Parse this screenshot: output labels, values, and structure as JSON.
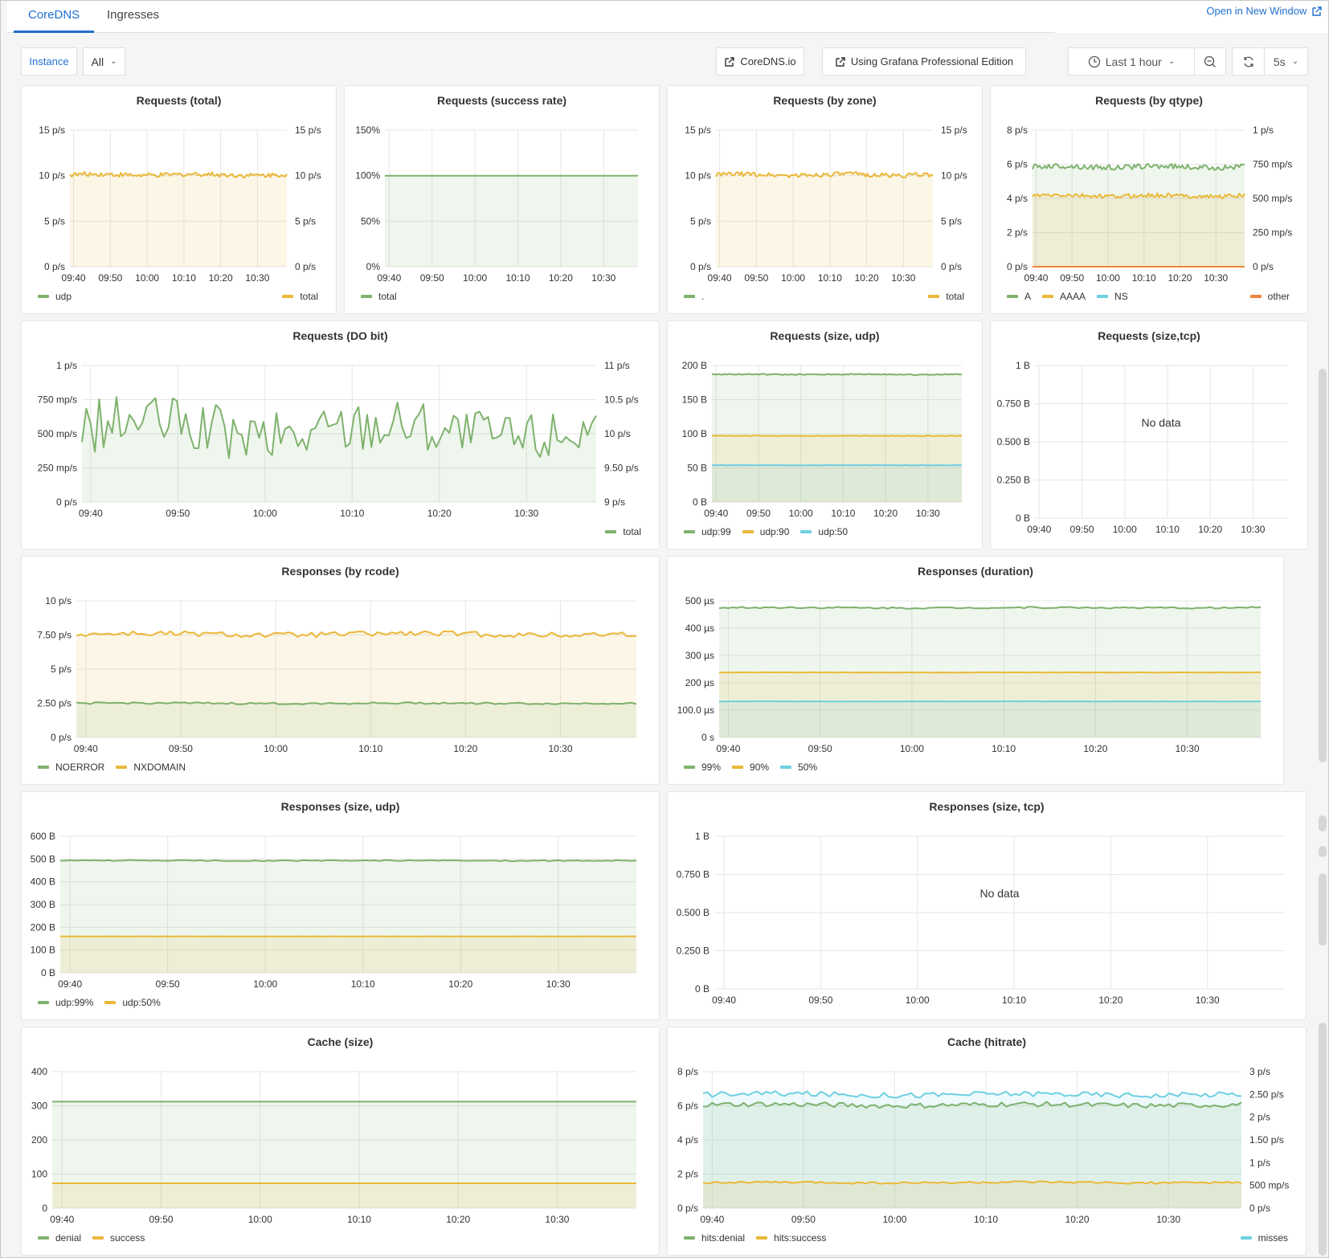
{
  "tabs": [
    {
      "label": "CoreDNS",
      "active": true
    },
    {
      "label": "Ingresses",
      "active": false
    }
  ],
  "open_new_window": "Open in New Window",
  "toolbar": {
    "variable_label": "Instance",
    "variable_value": "All",
    "link_coredns": "CoreDNS.io",
    "link_grafana": "Using Grafana Professional Edition",
    "time_range": "Last 1 hour",
    "refresh_interval": "5s"
  },
  "colors": {
    "green": "#7eb26d",
    "yellow": "#eab839",
    "cyan": "#6ed0e0",
    "orange": "#ef843c",
    "accent": "#1f6fd1"
  },
  "x_ticks": [
    "09:40",
    "09:50",
    "10:00",
    "10:10",
    "10:20",
    "10:30"
  ],
  "chart_data": [
    {
      "id": "req-total",
      "type": "area",
      "title": "Requests (total)",
      "yleft": {
        "ticks": [
          "0 p/s",
          "5 p/s",
          "10 p/s",
          "15 p/s"
        ],
        "range": [
          0,
          15
        ]
      },
      "yright": {
        "ticks": [
          "0 p/s",
          "5 p/s",
          "10 p/s",
          "15 p/s"
        ],
        "range": [
          0,
          15
        ]
      },
      "series": [
        {
          "name": "udp",
          "color": "#7eb26d",
          "axis": "left",
          "mean": null,
          "noise": 0,
          "legend_side": "left"
        },
        {
          "name": "total",
          "color": "#eab839",
          "axis": "right",
          "mean": 10.1,
          "noise": 0.25,
          "legend_side": "right"
        }
      ]
    },
    {
      "id": "req-success",
      "type": "area",
      "title": "Requests (success rate)",
      "yleft": {
        "ticks": [
          "0%",
          "50%",
          "100%",
          "150%"
        ],
        "range": [
          0,
          150
        ]
      },
      "series": [
        {
          "name": "total",
          "color": "#7eb26d",
          "axis": "left",
          "mean": 100,
          "noise": 0,
          "legend_side": "left"
        }
      ]
    },
    {
      "id": "req-zone",
      "type": "area",
      "title": "Requests (by zone)",
      "yleft": {
        "ticks": [
          "0 p/s",
          "5 p/s",
          "10 p/s",
          "15 p/s"
        ],
        "range": [
          0,
          15
        ]
      },
      "yright": {
        "ticks": [
          "0 p/s",
          "5 p/s",
          "10 p/s",
          "15 p/s"
        ],
        "range": [
          0,
          15
        ]
      },
      "series": [
        {
          "name": ".",
          "color": "#7eb26d",
          "axis": "left",
          "mean": null,
          "noise": 0,
          "legend_side": "left"
        },
        {
          "name": "total",
          "color": "#eab839",
          "axis": "right",
          "mean": 10.1,
          "noise": 0.25,
          "legend_side": "right"
        }
      ]
    },
    {
      "id": "req-qtype",
      "type": "area",
      "title": "Requests (by qtype)",
      "yleft": {
        "ticks": [
          "0 p/s",
          "2 p/s",
          "4 p/s",
          "6 p/s",
          "8 p/s"
        ],
        "range": [
          0,
          8
        ]
      },
      "yright": {
        "ticks": [
          "0 p/s",
          "250 mp/s",
          "500 mp/s",
          "750 mp/s",
          "1 p/s"
        ],
        "range": [
          0,
          1
        ]
      },
      "series": [
        {
          "name": "A",
          "color": "#7eb26d",
          "axis": "left",
          "mean": 5.85,
          "noise": 0.15,
          "legend_side": "left"
        },
        {
          "name": "AAAA",
          "color": "#eab839",
          "axis": "left",
          "mean": 4.15,
          "noise": 0.12,
          "legend_side": "left"
        },
        {
          "name": "NS",
          "color": "#6ed0e0",
          "axis": "left",
          "mean": null,
          "noise": 0,
          "legend_side": "left"
        },
        {
          "name": "other",
          "color": "#ef843c",
          "axis": "right",
          "mean": 0,
          "noise": 0,
          "legend_side": "right"
        }
      ]
    },
    {
      "id": "req-dobit",
      "type": "area",
      "title": "Requests (DO bit)",
      "yleft": {
        "ticks": [
          "0 p/s",
          "250 mp/s",
          "500 mp/s",
          "750 mp/s",
          "1 p/s"
        ],
        "range": [
          0,
          1
        ]
      },
      "yright": {
        "ticks": [
          "9 p/s",
          "9.50 p/s",
          "10 p/s",
          "10.5 p/s",
          "11 p/s"
        ],
        "range": [
          9,
          11
        ]
      },
      "series": [
        {
          "name": "total",
          "color": "#7eb26d",
          "axis": "left",
          "mean": 0.53,
          "noise": 0.2,
          "legend_side": "right"
        }
      ]
    },
    {
      "id": "req-size-udp",
      "type": "area",
      "title": "Requests (size, udp)",
      "yleft": {
        "ticks": [
          "0 B",
          "50 B",
          "100 B",
          "150 B",
          "200 B"
        ],
        "range": [
          0,
          200
        ]
      },
      "series": [
        {
          "name": "udp:99",
          "color": "#7eb26d",
          "axis": "left",
          "mean": 187,
          "noise": 0.8,
          "legend_side": "left"
        },
        {
          "name": "udp:90",
          "color": "#eab839",
          "axis": "left",
          "mean": 97,
          "noise": 0.5,
          "legend_side": "left"
        },
        {
          "name": "udp:50",
          "color": "#6ed0e0",
          "axis": "left",
          "mean": 54,
          "noise": 0.3,
          "legend_side": "left"
        }
      ]
    },
    {
      "id": "req-size-tcp",
      "type": "area",
      "title": "Requests (size,tcp)",
      "no_data": "No data",
      "yleft": {
        "ticks": [
          "0 B",
          "0.250 B",
          "0.500 B",
          "0.750 B",
          "1 B"
        ],
        "range": [
          0,
          1
        ]
      },
      "series": []
    },
    {
      "id": "resp-rcode",
      "type": "area",
      "title": "Responses (by rcode)",
      "yleft": {
        "ticks": [
          "0 p/s",
          "2.50 p/s",
          "5 p/s",
          "7.50 p/s",
          "10 p/s"
        ],
        "range": [
          0,
          10
        ]
      },
      "series": [
        {
          "name": "NOERROR",
          "color": "#7eb26d",
          "axis": "left",
          "mean": 2.5,
          "noise": 0.07,
          "legend_side": "left"
        },
        {
          "name": "NXDOMAIN",
          "color": "#eab839",
          "axis": "left",
          "mean": 7.55,
          "noise": 0.2,
          "legend_side": "left"
        }
      ]
    },
    {
      "id": "resp-duration",
      "type": "area",
      "title": "Responses (duration)",
      "yleft": {
        "ticks": [
          "0 s",
          "100.0 µs",
          "200 µs",
          "300 µs",
          "400 µs",
          "500 µs"
        ],
        "range": [
          0,
          500
        ]
      },
      "series": [
        {
          "name": "99%",
          "color": "#7eb26d",
          "axis": "left",
          "mean": 475,
          "noise": 3,
          "legend_side": "left"
        },
        {
          "name": "90%",
          "color": "#eab839",
          "axis": "left",
          "mean": 238,
          "noise": 0.5,
          "legend_side": "left"
        },
        {
          "name": "50%",
          "color": "#6ed0e0",
          "axis": "left",
          "mean": 132,
          "noise": 0.3,
          "legend_side": "left"
        }
      ]
    },
    {
      "id": "resp-size-udp",
      "type": "area",
      "title": "Responses (size, udp)",
      "yleft": {
        "ticks": [
          "0 B",
          "100 B",
          "200 B",
          "300 B",
          "400 B",
          "500 B",
          "600 B"
        ],
        "range": [
          0,
          600
        ]
      },
      "series": [
        {
          "name": "udp:99%",
          "color": "#7eb26d",
          "axis": "left",
          "mean": 493,
          "noise": 2,
          "legend_side": "left"
        },
        {
          "name": "udp:50%",
          "color": "#eab839",
          "axis": "left",
          "mean": 160,
          "noise": 0.3,
          "legend_side": "left"
        }
      ]
    },
    {
      "id": "resp-size-tcp",
      "type": "area",
      "title": "Responses (size, tcp)",
      "no_data": "No data",
      "yleft": {
        "ticks": [
          "0 B",
          "0.250 B",
          "0.500 B",
          "0.750 B",
          "1 B"
        ],
        "range": [
          0,
          1
        ]
      },
      "series": []
    },
    {
      "id": "cache-size",
      "type": "area",
      "title": "Cache (size)",
      "yleft": {
        "ticks": [
          "0",
          "100",
          "200",
          "300",
          "400"
        ],
        "range": [
          0,
          400
        ]
      },
      "series": [
        {
          "name": "denial",
          "color": "#7eb26d",
          "axis": "left",
          "mean": 312,
          "noise": 0,
          "legend_side": "left"
        },
        {
          "name": "success",
          "color": "#eab839",
          "axis": "left",
          "mean": 73,
          "noise": 0,
          "legend_side": "left"
        }
      ]
    },
    {
      "id": "cache-hitrate",
      "type": "area",
      "title": "Cache (hitrate)",
      "yleft": {
        "ticks": [
          "0 p/s",
          "2 p/s",
          "4 p/s",
          "6 p/s",
          "8 p/s"
        ],
        "range": [
          0,
          8
        ]
      },
      "yright": {
        "ticks": [
          "0 p/s",
          "500 mp/s",
          "1 p/s",
          "1.50 p/s",
          "2 p/s",
          "2.50 p/s",
          "3 p/s"
        ],
        "range": [
          0,
          3
        ]
      },
      "series": [
        {
          "name": "hits:denial",
          "color": "#7eb26d",
          "axis": "left",
          "mean": 6.05,
          "noise": 0.15,
          "legend_side": "left"
        },
        {
          "name": "hits:success",
          "color": "#eab839",
          "axis": "left",
          "mean": 1.5,
          "noise": 0.06,
          "legend_side": "left"
        },
        {
          "name": "misses",
          "color": "#6ed0e0",
          "axis": "right",
          "mean": 2.5,
          "noise": 0.06,
          "legend_side": "right"
        }
      ]
    }
  ]
}
